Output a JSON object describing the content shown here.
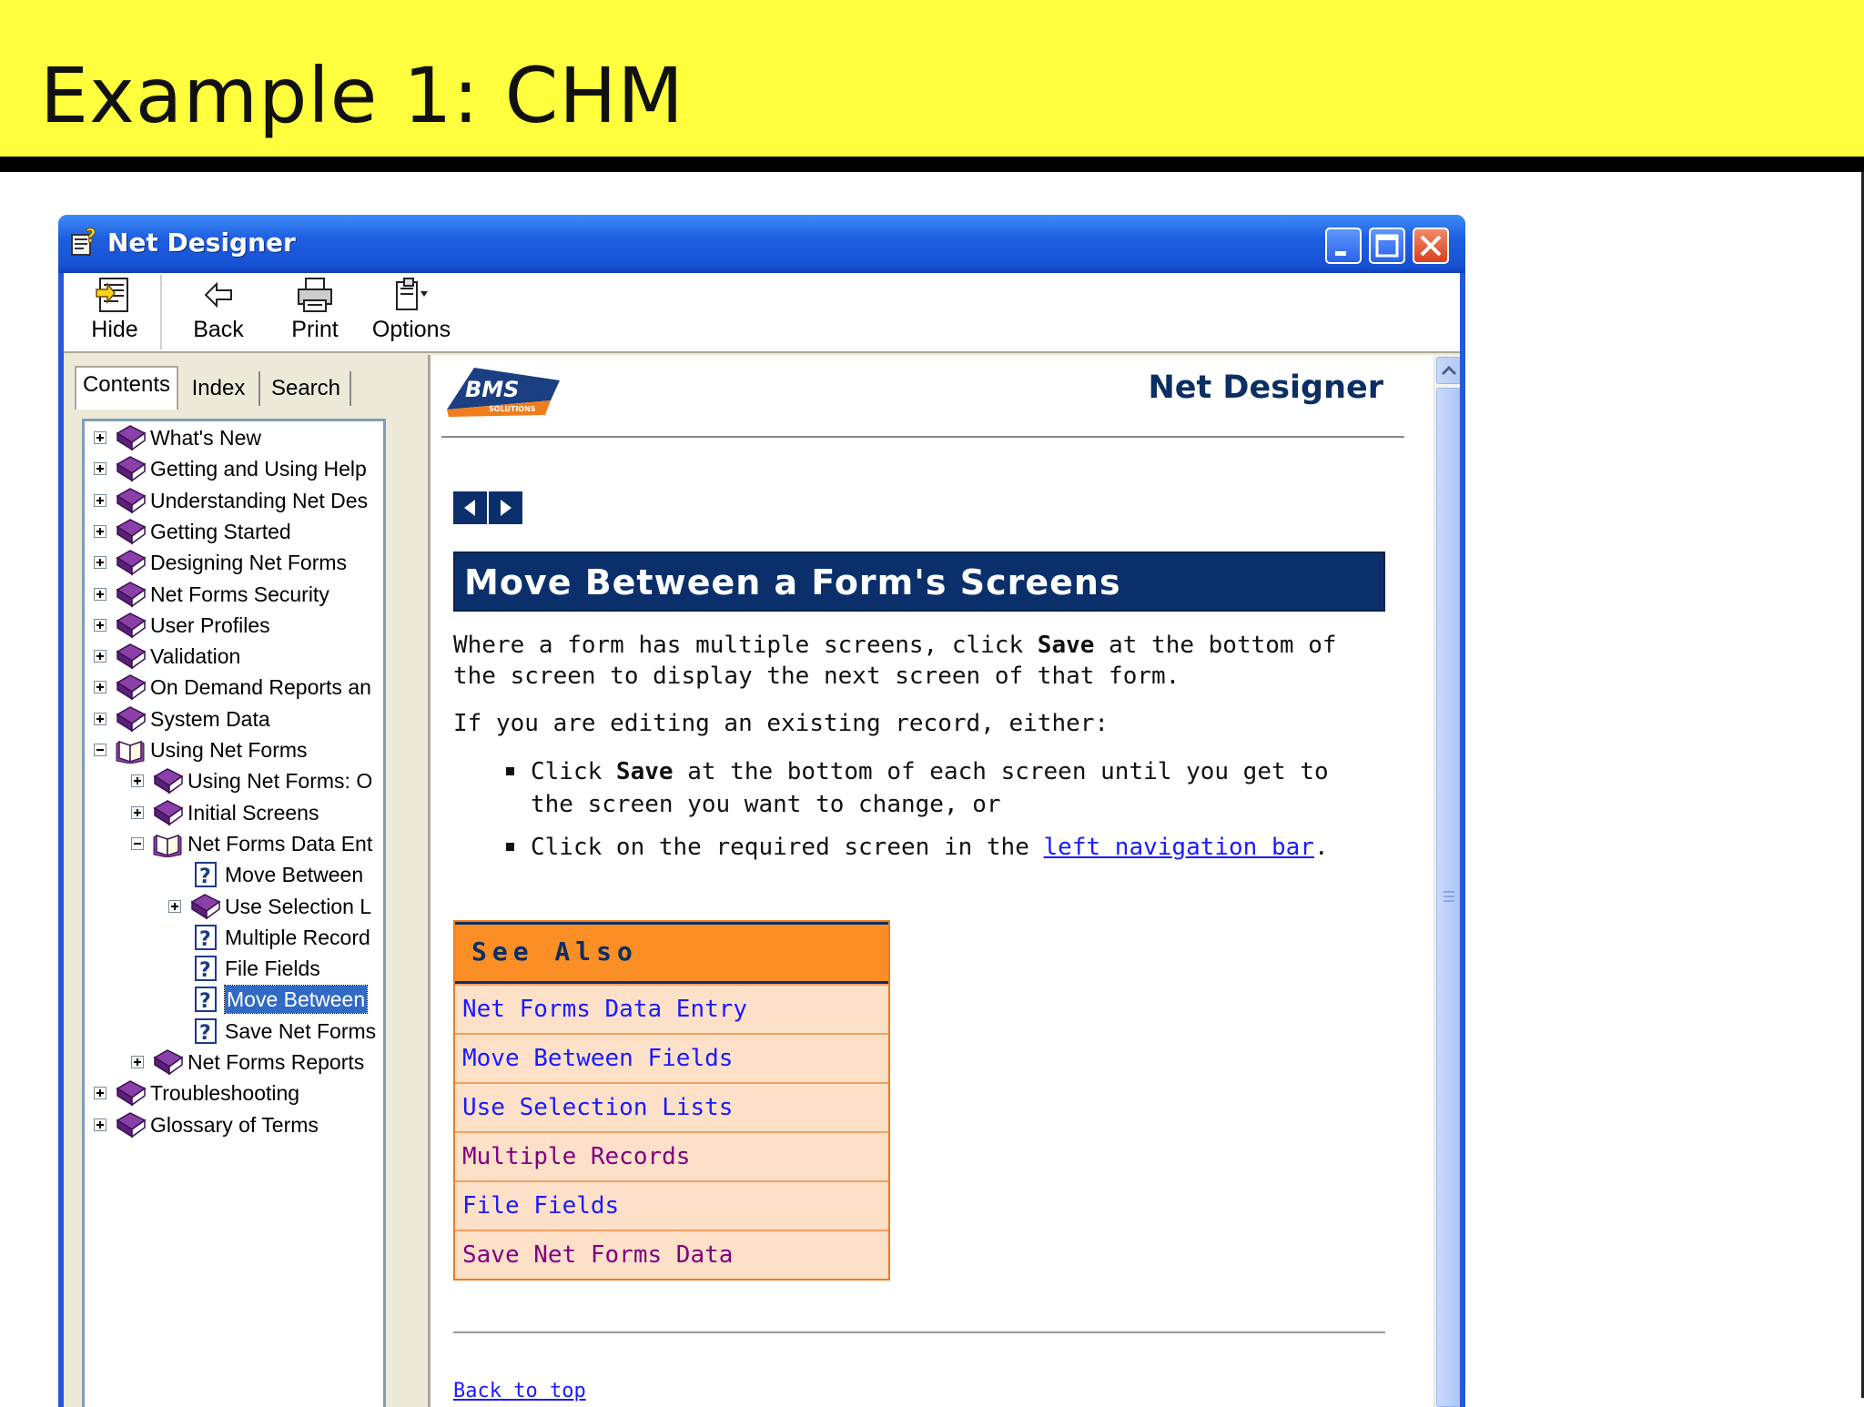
{
  "slide": {
    "title": "Example 1: CHM"
  },
  "window": {
    "title": "Net Designer"
  },
  "toolbar": {
    "hide": "Hide",
    "back": "Back",
    "print": "Print",
    "options": "Options"
  },
  "nav_tabs": {
    "contents": "Contents",
    "index": "Index",
    "search": "Search"
  },
  "tree": [
    {
      "label": "What's New",
      "level": 0,
      "expander": "plus",
      "icon": "book-closed-icon"
    },
    {
      "label": "Getting and Using Help",
      "level": 0,
      "expander": "plus",
      "icon": "book-closed-icon"
    },
    {
      "label": "Understanding Net Des",
      "level": 0,
      "expander": "plus",
      "icon": "book-closed-icon"
    },
    {
      "label": "Getting Started",
      "level": 0,
      "expander": "plus",
      "icon": "book-closed-icon"
    },
    {
      "label": "Designing Net Forms",
      "level": 0,
      "expander": "plus",
      "icon": "book-closed-icon"
    },
    {
      "label": "Net Forms Security",
      "level": 0,
      "expander": "plus",
      "icon": "book-closed-icon"
    },
    {
      "label": "User Profiles",
      "level": 0,
      "expander": "plus",
      "icon": "book-closed-icon"
    },
    {
      "label": "Validation",
      "level": 0,
      "expander": "plus",
      "icon": "book-closed-icon"
    },
    {
      "label": "On Demand Reports an",
      "level": 0,
      "expander": "plus",
      "icon": "book-closed-icon"
    },
    {
      "label": "System Data",
      "level": 0,
      "expander": "plus",
      "icon": "book-closed-icon"
    },
    {
      "label": "Using Net Forms",
      "level": 0,
      "expander": "minus",
      "icon": "book-open-icon"
    },
    {
      "label": "Using Net Forms: O",
      "level": 1,
      "expander": "plus",
      "icon": "book-closed-icon"
    },
    {
      "label": "Initial Screens",
      "level": 1,
      "expander": "plus",
      "icon": "book-closed-icon"
    },
    {
      "label": "Net Forms Data Ent",
      "level": 1,
      "expander": "minus",
      "icon": "book-open-icon"
    },
    {
      "label": "Move Between",
      "level": 2,
      "expander": "none",
      "icon": "help-page-icon"
    },
    {
      "label": "Use Selection L",
      "level": 2,
      "expander": "plus",
      "icon": "book-closed-icon"
    },
    {
      "label": "Multiple Record",
      "level": 2,
      "expander": "none",
      "icon": "help-page-icon"
    },
    {
      "label": "File Fields",
      "level": 2,
      "expander": "none",
      "icon": "help-page-icon"
    },
    {
      "label": "Move Between",
      "level": 2,
      "expander": "none",
      "icon": "help-page-icon",
      "selected": true
    },
    {
      "label": "Save Net Forms",
      "level": 2,
      "expander": "none",
      "icon": "help-page-icon"
    },
    {
      "label": "Net Forms Reports",
      "level": 1,
      "expander": "plus",
      "icon": "book-closed-icon"
    },
    {
      "label": "Troubleshooting",
      "level": 0,
      "expander": "plus",
      "icon": "book-closed-icon"
    },
    {
      "label": "Glossary of Terms",
      "level": 0,
      "expander": "plus",
      "icon": "book-closed-icon"
    }
  ],
  "content": {
    "logo_text": "BMS",
    "logo_sub": "SOLUTIONS",
    "brand_title": "Net Designer",
    "heading": "Move Between a Form's Screens",
    "p1_a": "Where a form has multiple screens, click ",
    "p1_bold": "Save",
    "p1_b": " at the bottom of the screen to display the next screen of that form.",
    "p2": "If you are editing an existing record, either:",
    "b1_a": "Click ",
    "b1_bold": "Save",
    "b1_b": " at the bottom of each screen until you get to the screen you want to change, or",
    "b2_a": "Click on the required screen in the ",
    "b2_link": "left navigation bar",
    "b2_b": ".",
    "see_also_title": "See Also",
    "see_also": [
      {
        "label": "Net Forms Data Entry",
        "visited": false
      },
      {
        "label": "Move Between Fields",
        "visited": false
      },
      {
        "label": "Use Selection Lists",
        "visited": false
      },
      {
        "label": "Multiple Records",
        "visited": true
      },
      {
        "label": "File Fields",
        "visited": false
      },
      {
        "label": "Save Net Forms Data",
        "visited": true
      }
    ],
    "back_to_top": "Back to top"
  },
  "colors": {
    "slide_band": "#ffff3d",
    "heading_bar": "#0b2f6a",
    "see_also_head": "#fb8f26",
    "see_also_bg": "#fde0c8",
    "link": "#1a1aff",
    "visited_link": "#800080",
    "selection": "#316ac5"
  }
}
